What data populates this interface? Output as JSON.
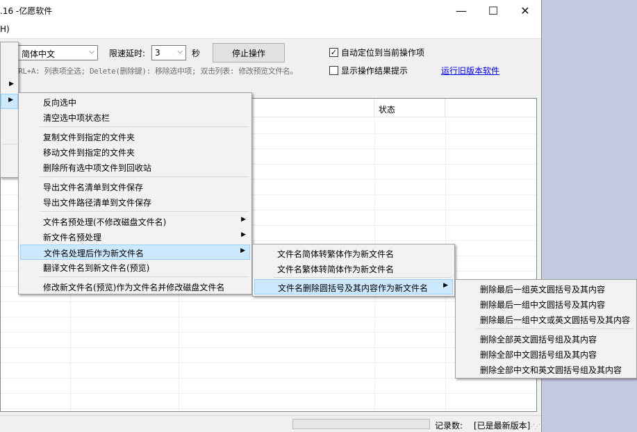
{
  "window": {
    "title": ".16 -亿愿软件",
    "minimize_glyph": "—",
    "maximize_glyph": "☐",
    "close_glyph": "✕"
  },
  "menubar": {
    "partial_item": "H)"
  },
  "toolbar": {
    "language_value": "简体中文",
    "delay_label": "限速延时:",
    "delay_value": "3",
    "seconds_label": "秒",
    "stop_button": "停止操作",
    "auto_locate_label": "自动定位到当前操作项",
    "auto_locate_checked": "✓",
    "show_result_label": "显示操作结果提示",
    "hint_text": "TRL+A: 列表项全选; Delete(删除键): 移除选中项; 双击列表: 修改预览文件名。",
    "old_version_link": "运行旧版本软件"
  },
  "list": {
    "status_column": "状态"
  },
  "statusbar": {
    "progress_fraction": 0,
    "records_label": "记录数:",
    "version_status": "[已是最新版本]"
  },
  "menu_main": {
    "items": [
      "反向选中",
      "清空选中项状态栏",
      "复制文件到指定的文件夹",
      "移动文件到指定的文件夹",
      "删除所有选中项文件到回收站",
      "导出文件名清单到文件保存",
      "导出文件路径清单到文件保存",
      "文件名预处理(不修改磁盘文件名)",
      "新文件名预处理",
      "文件名处理后作为新文件名",
      "翻译文件名到新文件名(预览)",
      "修改新文件名(预览)作为文件名并修改磁盘文件名"
    ]
  },
  "menu_sub1": {
    "items": [
      "文件名简体转繁体作为新文件名",
      "文件名繁体转简体作为新文件名",
      "文件名删除圆括号及其内容作为新文件名"
    ]
  },
  "menu_sub2": {
    "items": [
      "删除最后一组英文圆括号及其内容",
      "删除最后一组中文圆括号及其内容",
      "删除最后一组中文或英文圆括号及其内容",
      "删除全部英文圆括号组及其内容",
      "删除全部中文圆括号组及其内容",
      "删除全部中文和英文圆括号组及其内容"
    ]
  },
  "icons": {
    "submenu_arrow": "▶",
    "dropdown_arrow": "⌵"
  }
}
